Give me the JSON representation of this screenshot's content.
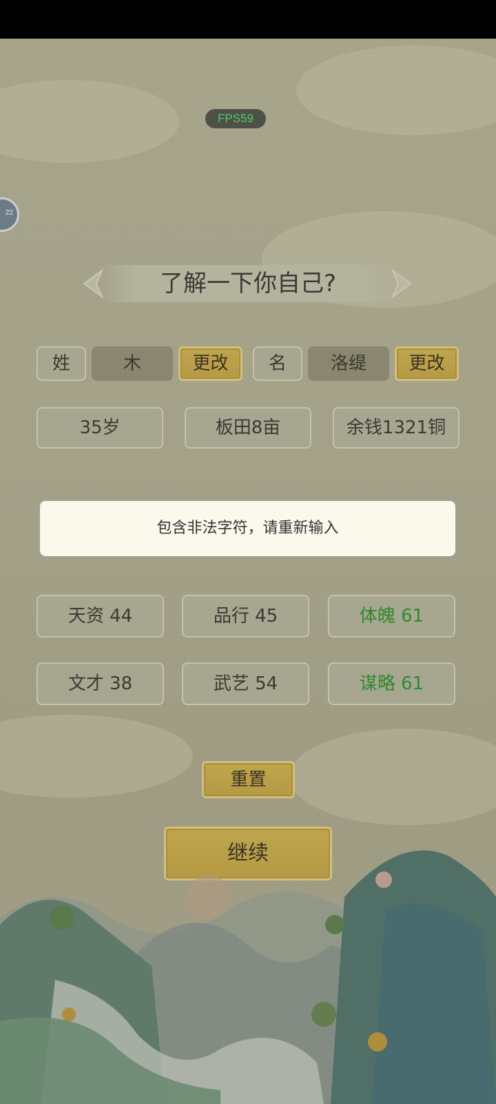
{
  "fps": "FPS59",
  "avatar_badge": "22",
  "title": "了解一下你自己?",
  "surname": {
    "label": "姓",
    "value": "木",
    "change_label": "更改"
  },
  "givenname": {
    "label": "名",
    "value": "洛缇",
    "change_label": "更改"
  },
  "info": {
    "age": "35岁",
    "land": "板田8亩",
    "money": "余钱1321铜"
  },
  "toast": "包含非法字符，请重新输入",
  "stats": [
    {
      "label": "天资 44",
      "highlight": false
    },
    {
      "label": "品行 45",
      "highlight": false
    },
    {
      "label": "体魄 61",
      "highlight": true
    },
    {
      "label": "文才 38",
      "highlight": false
    },
    {
      "label": "武艺 54",
      "highlight": false
    },
    {
      "label": "谋略 61",
      "highlight": true
    }
  ],
  "reset_label": "重置",
  "continue_label": "继续",
  "colors": {
    "gold": "#b89e47",
    "highlight_green": "#2f8a2e",
    "toast_bg": "#fbf8ec"
  }
}
